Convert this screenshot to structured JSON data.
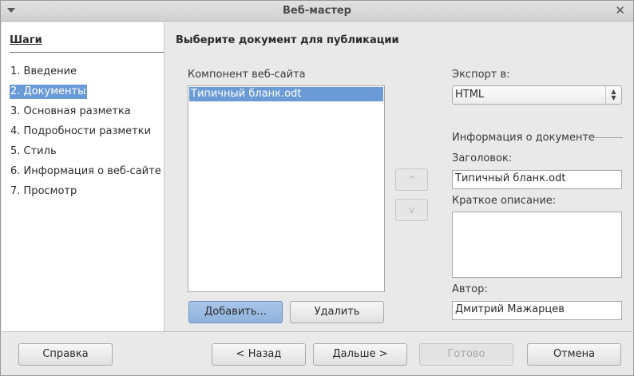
{
  "window": {
    "title": "Веб-мастер"
  },
  "steps": {
    "title": "Шаги",
    "items": [
      {
        "label": "1. Введение"
      },
      {
        "label": "2. Документы"
      },
      {
        "label": "3. Основная разметка"
      },
      {
        "label": "4. Подробности разметки"
      },
      {
        "label": "5. Стиль"
      },
      {
        "label": "6. Информация о веб-сайте"
      },
      {
        "label": "7. Просмотр"
      }
    ],
    "active_index": 1
  },
  "main": {
    "heading": "Выберите документ для публикации",
    "component_label": "Компонент веб-сайта",
    "documents": [
      "Типичный бланк.odt"
    ],
    "add_button": "Добавить...",
    "remove_button": "Удалить",
    "move_up": "^",
    "move_down": "v",
    "export_label": "Экспорт в:",
    "export_value": "HTML",
    "info_group": "Информация о документе",
    "title_label": "Заголовок:",
    "title_value": "Типичный бланк.odt",
    "description_label": "Краткое описание:",
    "description_value": "",
    "author_label": "Автор:",
    "author_value": "Дмитрий  Мажарцев"
  },
  "footer": {
    "help": "Справка",
    "back": "< Назад",
    "next": "Дальше >",
    "finish": "Готово",
    "cancel": "Отмена"
  }
}
